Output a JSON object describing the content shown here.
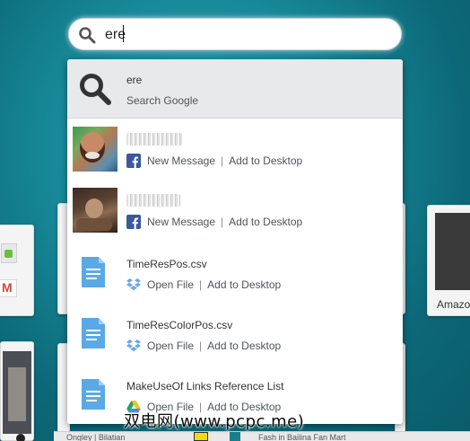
{
  "search": {
    "query": "ere",
    "placeholder": ""
  },
  "google_result": {
    "title": "ere",
    "subtitle": "Search Google"
  },
  "results": [
    {
      "type": "contact",
      "name": "████████",
      "icon": "facebook-icon",
      "action1": "New Message",
      "action2": "Add to Desktop"
    },
    {
      "type": "contact",
      "name": "██████",
      "icon": "facebook-icon",
      "action1": "New Message",
      "action2": "Add to Desktop"
    },
    {
      "type": "file",
      "name": "TimeResPos.csv",
      "icon": "dropbox-icon",
      "action1": "Open File",
      "action2": "Add to Desktop"
    },
    {
      "type": "file",
      "name": "TimeResColorPos.csv",
      "icon": "dropbox-icon",
      "action1": "Open File",
      "action2": "Add to Desktop"
    },
    {
      "type": "file",
      "name": "MakeUseOf Links Reference List",
      "icon": "google-drive-icon",
      "action1": "Open File",
      "action2": "Add to Desktop"
    }
  ],
  "background": {
    "right_card_label": "Amazo",
    "bottom_strip": {
      "left": "Ongley | Bilatian",
      "right": "Fash in Bailina Fan Mart"
    }
  },
  "watermark": "双电网(www.pcpc.me)",
  "colors": {
    "accent_teal": "#178998",
    "facebook_blue": "#3b5998",
    "dropbox_blue": "#6aa9e8",
    "file_blue": "#5aa9e6"
  }
}
